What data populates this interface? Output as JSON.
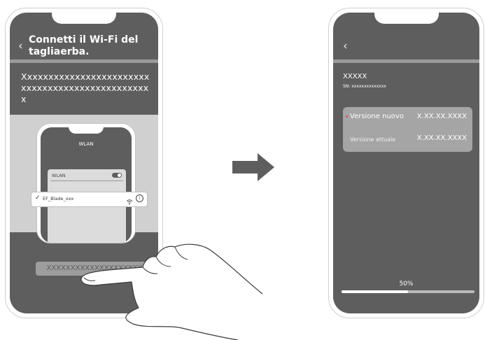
{
  "left_phone": {
    "back_icon": "chevron-left-icon",
    "title": "Connetti il Wi-Fi del tagliaerba.",
    "instruction": "Xxxxxxxxxxxxxxxxxxxxxxxxxxxxxxxxxxxxxxxxxxxxxxxxx",
    "illustration": {
      "header": "WLAN",
      "wlan_label": "WLAN",
      "network_name": "EF_Blade_xxx",
      "check_icon": "checkmark-icon",
      "wifi_icon": "wifi-icon",
      "info_icon": "info-icon"
    },
    "button_label": "XXXXXXXXXXXXXXXXXXXX"
  },
  "arrow_icon": "right-arrow-icon",
  "right_phone": {
    "back_icon": "chevron-left-icon",
    "device_name": "XXXXX",
    "serial": "SN: xxxxxxxxxxxxxx",
    "new_version_label": "Versione nuovo",
    "new_version_value": "X.XX.XX.XXXX",
    "current_version_label": "Versione attuale",
    "current_version_value": "X.XX.XX.XXXX",
    "progress_label": "50%",
    "progress_fraction": 0.5
  },
  "colors": {
    "screen_bg": "#5e5e5e",
    "separator": "#9a9a9a",
    "card": "#a5a5a5",
    "new_version_dot": "#d9534f"
  }
}
